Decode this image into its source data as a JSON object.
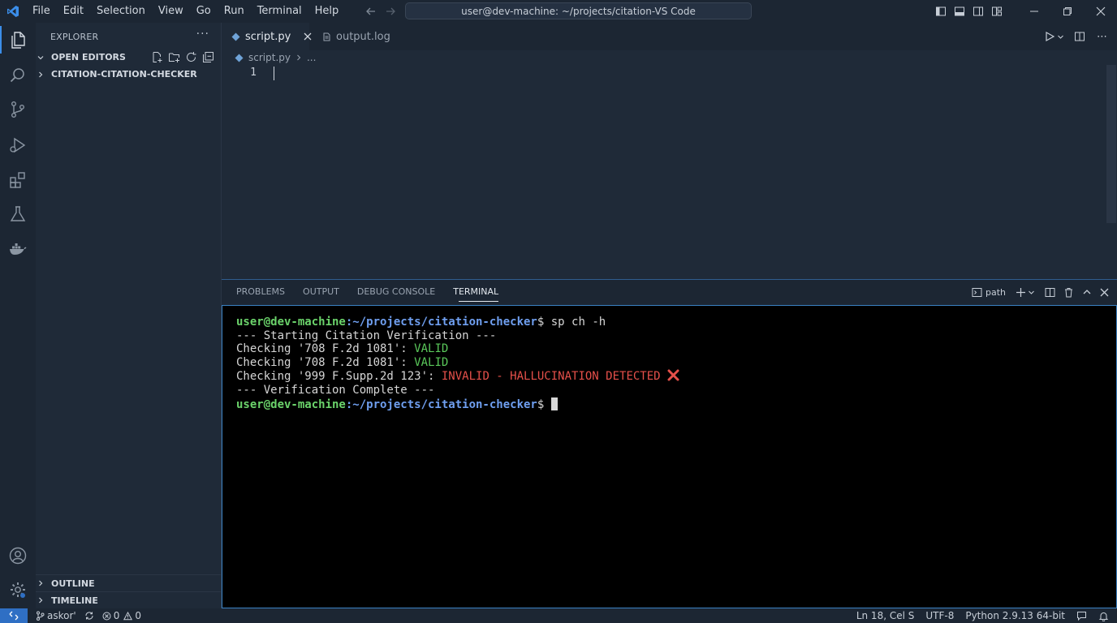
{
  "titlebar": {
    "menu": [
      "File",
      "Edit",
      "Selection",
      "View",
      "Go",
      "Run",
      "Terminal",
      "Help"
    ],
    "command_center": "user@dev-machine: ~/projects/citation-VS Code"
  },
  "sidebar": {
    "title": "EXPLORER",
    "more": "···",
    "sections": {
      "open_editors": "OPEN EDITORS",
      "folder": "CITATION-CITATION-CHECKER",
      "outline": "OUTLINE",
      "timeline": "TIMELINE"
    }
  },
  "tabs": [
    {
      "label": "script.py",
      "active": true
    },
    {
      "label": "output.log",
      "active": false
    }
  ],
  "breadcrumb": {
    "file": "script.py",
    "rest": "..."
  },
  "editor": {
    "line_numbers": [
      "1"
    ]
  },
  "panel": {
    "tabs": [
      "PROBLEMS",
      "OUTPUT",
      "DEBUG CONSOLE",
      "TERMINAL"
    ],
    "active_tab": "TERMINAL",
    "terminal_profile": "path"
  },
  "terminal": {
    "user": "user@dev-machine",
    "path": ":~/projects/citation-checker",
    "prompt_symbol": "$",
    "command": " sp ch -h",
    "line_start": "--- Starting Citation Verification ---",
    "check1_prefix": "Checking '708 F.2d 1081': ",
    "check1_status": "VALID",
    "check2_prefix": "Checking '708 F.2d 1081': ",
    "check2_status": "VALID",
    "check3_prefix": "Checking '999 F.Supp.2d 123': ",
    "check3_status": "INVALID - HALLUCINATION DETECTED",
    "line_end": "--- Verification Complete ---"
  },
  "statusbar": {
    "branch": "askor'",
    "errors": "0",
    "warnings": "0",
    "position": "Ln 18, Cel S",
    "encoding": "UTF-8",
    "interpreter": "Python 2.9.13 64-bit"
  },
  "colors": {
    "accent": "#3b8eea",
    "remote": "#2f6fc4",
    "valid": "#5ac85a",
    "invalid": "#e5504a",
    "prompt_user": "#6bd36b",
    "prompt_path": "#6f9ff0"
  }
}
